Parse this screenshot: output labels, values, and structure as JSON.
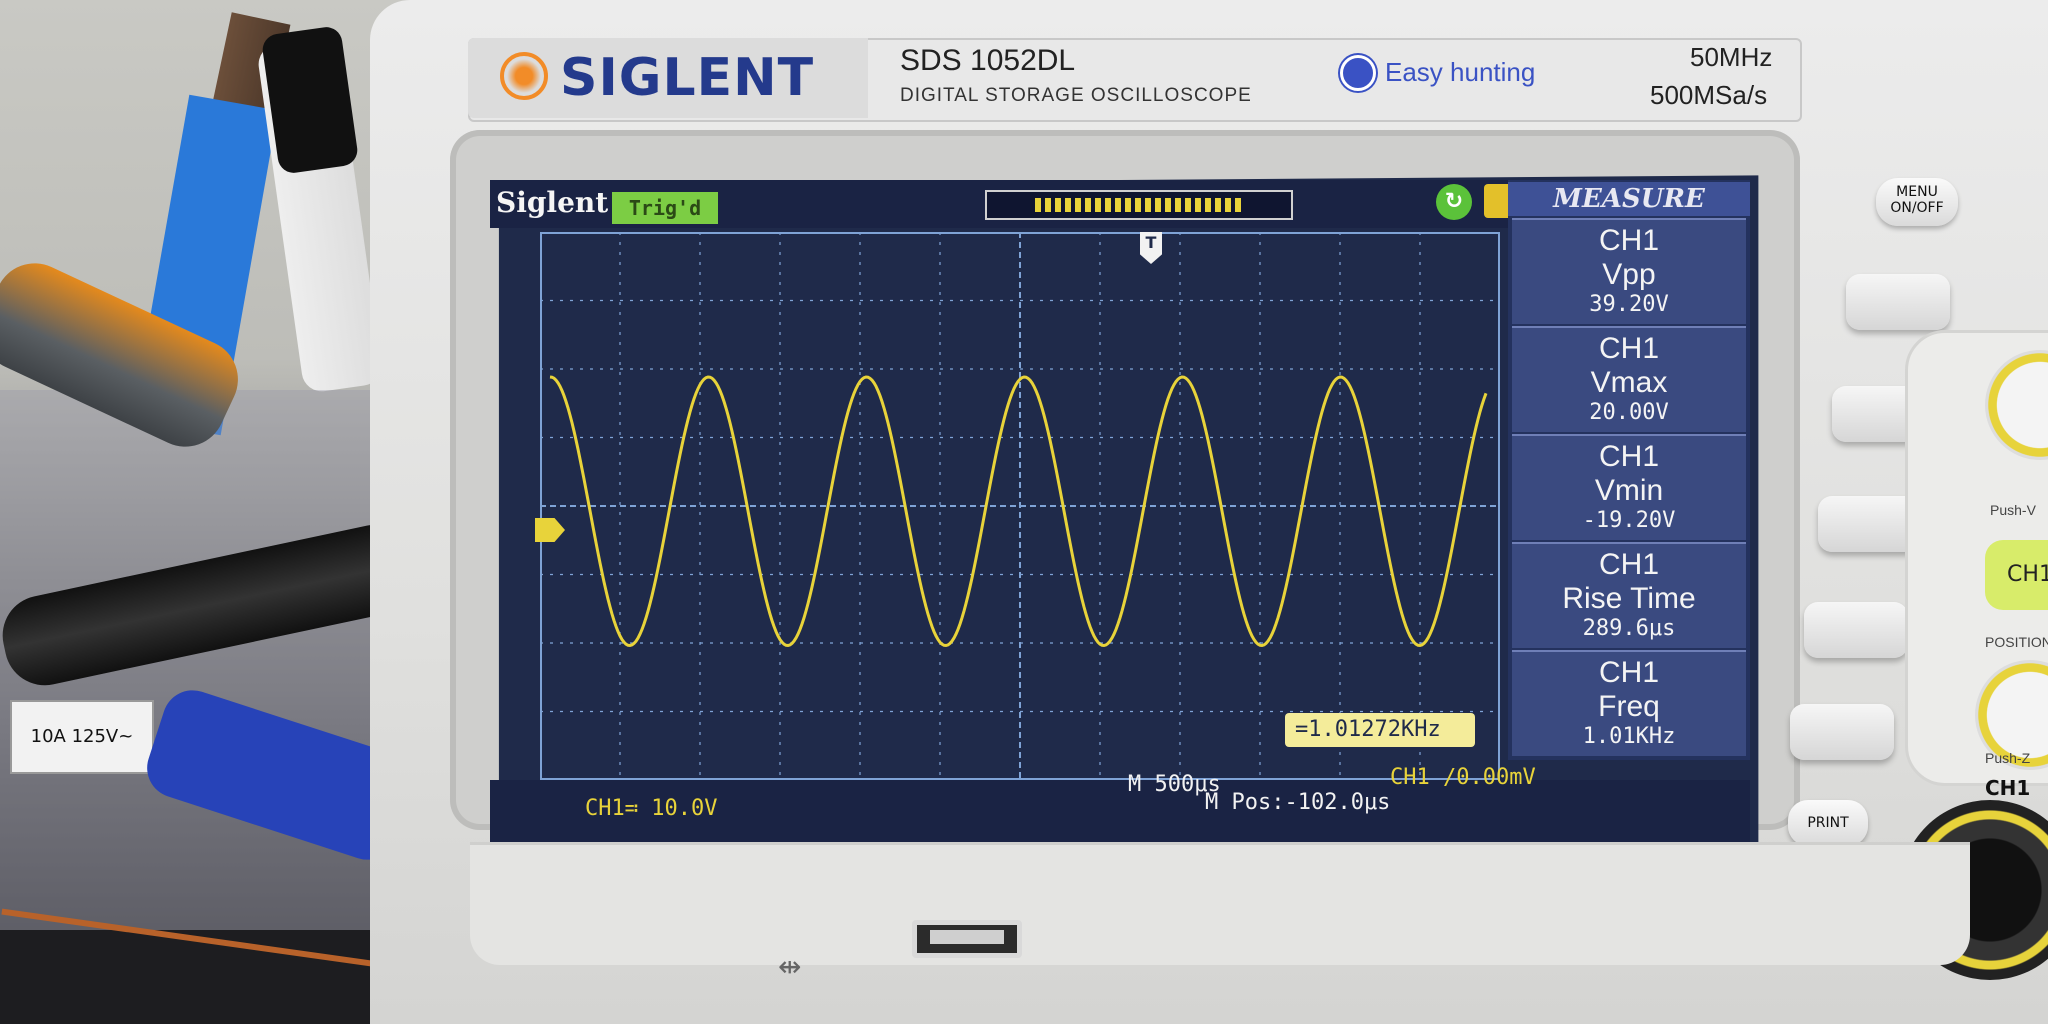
{
  "device": {
    "brand": "SIGLENT",
    "model": "SDS 1052DL",
    "model_subtitle": "DIGITAL STORAGE OSCILLOSCOPE",
    "feature": "Easy hunting",
    "bandwidth": "50MHz",
    "sample_rate": "500MSa/s"
  },
  "screen": {
    "brand_label": "Siglent",
    "trigger_status": "Trig'd",
    "measure_title": "MEASURE",
    "measurements": [
      {
        "channel": "CH1",
        "name": "Vpp",
        "value": "39.20V"
      },
      {
        "channel": "CH1",
        "name": "Vmax",
        "value": "20.00V"
      },
      {
        "channel": "CH1",
        "name": "Vmin",
        "value": "-19.20V"
      },
      {
        "channel": "CH1",
        "name": "Rise Time",
        "value": "289.6μs"
      },
      {
        "channel": "CH1",
        "name": "Freq",
        "value": "1.01KHz"
      }
    ],
    "counter_readout": "=1.01272KHz",
    "ch1_scale": "CH1≕ 10.0V",
    "timebase": "M 500μs",
    "m_pos": "M Pos:-102.0μs",
    "trigger_info": "CH1 ∕0.00mV",
    "trigger_marker": "T",
    "trace_color": "#e8d33a",
    "grid_color": "#7fa3d6"
  },
  "buttons": {
    "menu": "MENU ON/OFF",
    "print": "PRINT",
    "ch1": "CH1",
    "ch1_bnc": "CH1"
  },
  "labels": {
    "push_v": "Push-V",
    "position": "POSITION",
    "push_z": "Push-Z"
  },
  "misc": {
    "tag_text": "10A 125V~"
  }
}
